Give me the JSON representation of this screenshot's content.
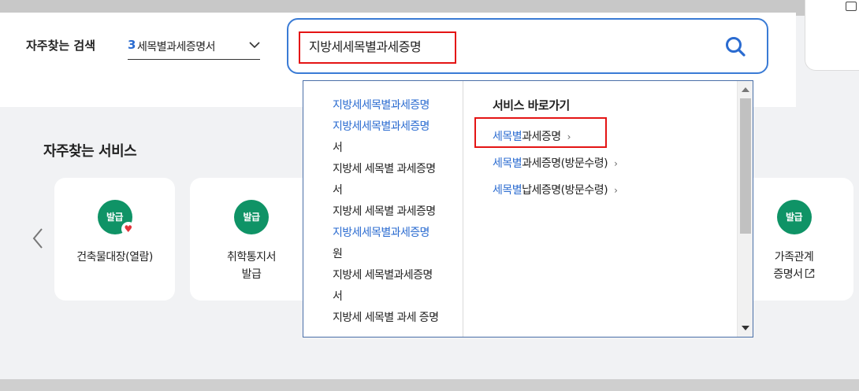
{
  "search_area": {
    "label": "자주찾는 검색",
    "select": {
      "number": "3",
      "text": "세목별과세증명서"
    },
    "query": "지방세세목별과세증명"
  },
  "suggestions": [
    {
      "hl": "지방세세목별과세증명",
      "rest": ""
    },
    {
      "hl": "지방세세목별과세증명",
      "rest": ""
    },
    {
      "hl": "",
      "rest": "서"
    },
    {
      "hl": "",
      "rest": "지방세 세목별 과세증명"
    },
    {
      "hl": "",
      "rest": "서"
    },
    {
      "hl": "",
      "rest": "지방세 세목별 과세증명"
    },
    {
      "hl": "지방세세목별과세증명",
      "rest": ""
    },
    {
      "hl": "",
      "rest": "원"
    },
    {
      "hl": "",
      "rest": "지방세 세목별과세증명"
    },
    {
      "hl": "",
      "rest": "서"
    },
    {
      "hl": "",
      "rest": "지방세 세목별 과세 증명"
    }
  ],
  "quick_links": {
    "title": "서비스 바로가기",
    "items": [
      {
        "hl": "세목별",
        "rest": "과세증명",
        "chevron": "›"
      },
      {
        "hl": "세목별",
        "rest": "과세증명(방문수령)",
        "chevron": "›"
      },
      {
        "hl": "세목별",
        "rest": "납세증명(방문수령)",
        "chevron": "›"
      }
    ]
  },
  "services": {
    "title": "자주찾는 서비스",
    "cards": [
      {
        "badge": "발급",
        "line1": "건축물대장(열람)",
        "line2": "",
        "favorite": true
      },
      {
        "badge": "발급",
        "line1": "취학통지서",
        "line2": "발급",
        "favorite": false
      },
      {
        "badge": "발급",
        "line1": "가족관계",
        "line2": "증명서",
        "favorite": false,
        "external": true
      }
    ]
  },
  "colors": {
    "accent": "#2a6bd0",
    "badge_green": "#0f9366",
    "highlight_red": "#e41414"
  },
  "icons": {
    "search": "search-icon",
    "chevron_down": "chevron-down-icon",
    "arrow_left": "arrow-left-icon",
    "heart": "heart-icon",
    "external_link": "external-link-icon"
  }
}
